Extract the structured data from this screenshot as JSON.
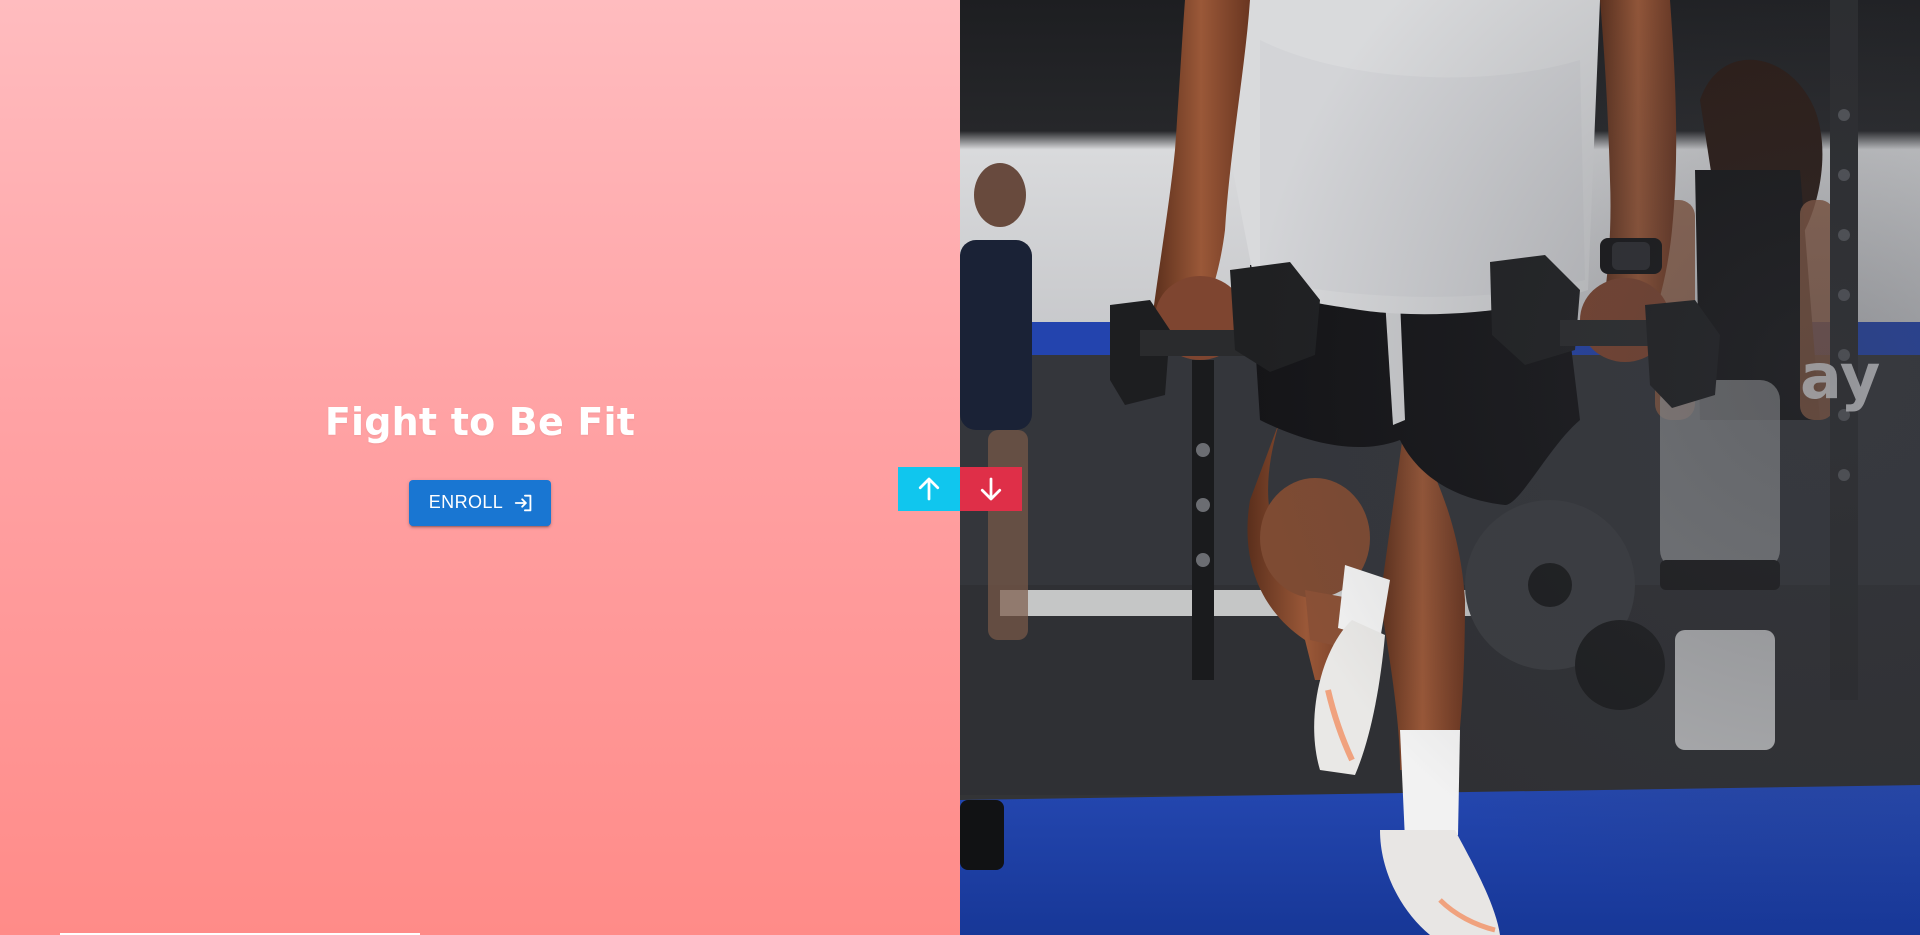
{
  "slide": {
    "title": "Fight to Be Fit",
    "button_label": "ENROLL",
    "button_icon": "login-icon"
  },
  "controls": {
    "up_icon": "arrow-up-icon",
    "down_icon": "arrow-down-icon",
    "up_color": "#10c6ee",
    "down_color": "#df2f48"
  },
  "colors": {
    "panel_gradient_top": "#ffbcbf",
    "panel_gradient_bottom": "#ff8b88",
    "button": "#1976d2",
    "turf": "#1d3ea3"
  },
  "photo": {
    "subject": "gym-dumbbell-lunge-photo",
    "wall_sign_fragment": "ay"
  }
}
